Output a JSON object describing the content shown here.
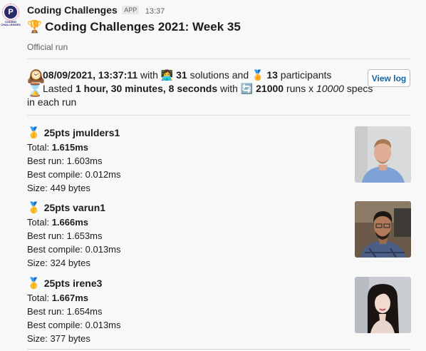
{
  "app": {
    "name": "Coding Challenges",
    "badge": "APP",
    "time": "13:37",
    "logo_caption": "CODING CHALLENGES"
  },
  "message": {
    "title": "Coding Challenges 2021: Week 35",
    "subtitle": "Official run"
  },
  "summary": {
    "date": "08/09/2021, 13:37:11",
    "with_1": " with ",
    "solutions_count": "31",
    "solutions_label": " solutions and ",
    "participants_count": "13",
    "participants_label": " participants",
    "lasted_label": "Lasted ",
    "duration": "1 hour, 30 minutes, 8 seconds",
    "with_2": " with ",
    "runs": "21000",
    "runs_label": " runs x ",
    "specs": "10000",
    "specs_label": " specs",
    "tail": "in each run"
  },
  "buttons": {
    "view_log": "View log"
  },
  "entries": [
    {
      "name": "25pts jmulders1",
      "total_label": "Total: ",
      "total": "1.615ms",
      "best_run": "Best run: 1.603ms",
      "best_compile": "Best compile: 0.012ms",
      "size": "Size: 449 bytes"
    },
    {
      "name": "25pts varun1",
      "total_label": "Total: ",
      "total": "1.666ms",
      "best_run": "Best run: 1.653ms",
      "best_compile": "Best compile: 0.013ms",
      "size": "Size: 324 bytes"
    },
    {
      "name": "25pts irene3",
      "total_label": "Total: ",
      "total": "1.667ms",
      "best_run": "Best run: 1.654ms",
      "best_compile": "Best compile: 0.013ms",
      "size": "Size: 377 bytes"
    }
  ],
  "icons": {
    "trophy": "🏆",
    "clock": "🕰️",
    "hourglass": "⌛",
    "technologist": "👩‍💻",
    "medal": "🏅",
    "repeat": "🔄",
    "gold": "🥇"
  }
}
